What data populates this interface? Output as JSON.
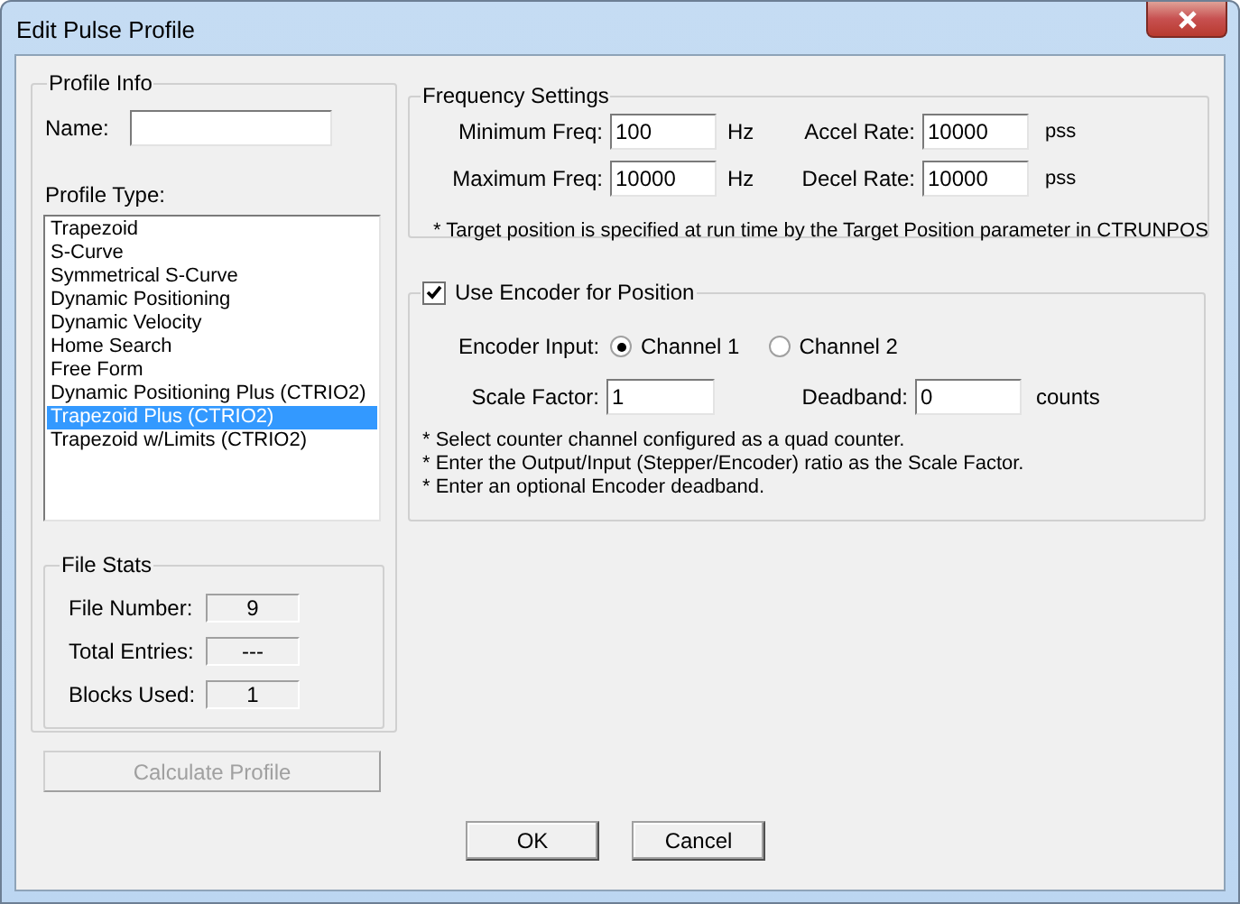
{
  "window": {
    "title": "Edit Pulse Profile"
  },
  "profile_info": {
    "title": "Profile Info",
    "name_label": "Name:",
    "type_label": "Profile Type:",
    "types": [
      {
        "label": "Trapezoid",
        "selected": false
      },
      {
        "label": "S-Curve",
        "selected": false
      },
      {
        "label": "Symmetrical S-Curve",
        "selected": false
      },
      {
        "label": "Dynamic Positioning",
        "selected": false
      },
      {
        "label": "Dynamic Velocity",
        "selected": false
      },
      {
        "label": "Home Search",
        "selected": false
      },
      {
        "label": "Free Form",
        "selected": false
      },
      {
        "label": "Dynamic Positioning Plus (CTRIO2)",
        "selected": false
      },
      {
        "label": "Trapezoid Plus (CTRIO2)",
        "selected": true
      },
      {
        "label": "Trapezoid w/Limits (CTRIO2)",
        "selected": false
      }
    ]
  },
  "file_stats": {
    "title": "File Stats",
    "rows": [
      {
        "label": "File Number:",
        "value": "9"
      },
      {
        "label": "Total Entries:",
        "value": "---"
      },
      {
        "label": "Blocks Used:",
        "value": "1"
      }
    ]
  },
  "calculate_button": {
    "label": "Calculate Profile",
    "disabled": true
  },
  "frequency_settings": {
    "title": "Frequency Settings",
    "fields": [
      {
        "label": "Minimum Freq:",
        "value": "100",
        "unit": "Hz"
      },
      {
        "label": "Accel Rate:",
        "value": "10000",
        "unit": "pss"
      },
      {
        "label": "Maximum Freq:",
        "value": "10000",
        "unit": "Hz"
      },
      {
        "label": "Decel Rate:",
        "value": "10000",
        "unit": "pss"
      }
    ],
    "note": "* Target position is specified at run time by the Target Position parameter in CTRUNPOS"
  },
  "encoder": {
    "label": "Use Encoder for Position",
    "checked": true,
    "input_label": "Encoder Input:",
    "channels": [
      {
        "label": "Channel 1",
        "selected": true
      },
      {
        "label": "Channel 2",
        "selected": false
      }
    ],
    "scale_factor": {
      "label": "Scale Factor:",
      "value": "1"
    },
    "deadband": {
      "label": "Deadband:",
      "value": "0",
      "unit": "counts"
    },
    "notes": [
      "* Select counter channel configured as a quad counter.",
      "* Enter the Output/Input (Stepper/Encoder) ratio as the Scale Factor.",
      "* Enter an optional Encoder deadband."
    ]
  },
  "buttons": [
    {
      "label": "OK"
    },
    {
      "label": "Cancel"
    }
  ]
}
